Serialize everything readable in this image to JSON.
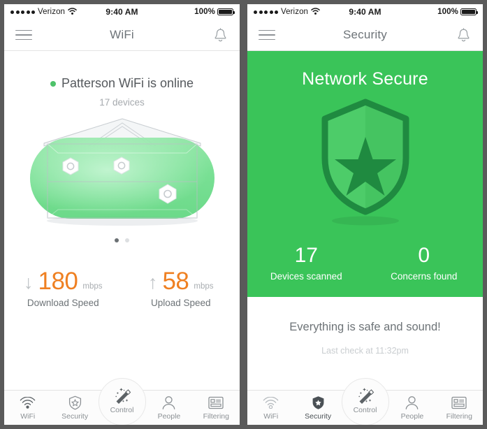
{
  "theme": {
    "green": "#3ac459",
    "orange": "#ef8022",
    "gutter": "#5a5a5a",
    "text_gray": "#6d7377",
    "muted_gray": "#a6aaae"
  },
  "status_bar": {
    "carrier": "Verizon",
    "signal_dots": 5,
    "wifi_icon": "wifi-icon",
    "time": "9:40 AM",
    "battery_percent": "100%",
    "battery_icon": "battery-full-icon"
  },
  "screens": [
    {
      "id": "wifi",
      "nav": {
        "menu_icon": "hamburger-menu-icon",
        "title": "WiFi",
        "notification_icon": "bell-icon"
      },
      "status": {
        "indicator_color": "#4ec26a",
        "text": "Patterson WiFi is online",
        "devices": "17 devices"
      },
      "illustration": "home-network-illustration",
      "pager": {
        "count": 2,
        "active": 0
      },
      "speeds": [
        {
          "direction_icon": "arrow-down-icon",
          "value": "180",
          "unit": "mbps",
          "label": "Download Speed"
        },
        {
          "direction_icon": "arrow-up-icon",
          "value": "58",
          "unit": "mbps",
          "label": "Upload Speed"
        }
      ]
    },
    {
      "id": "security",
      "nav": {
        "menu_icon": "hamburger-menu-icon",
        "title": "Security",
        "notification_icon": "bell-icon"
      },
      "banner": {
        "title": "Network Secure",
        "icon": "shield-star-icon",
        "background": "#3ac459"
      },
      "stats": [
        {
          "value": "17",
          "label": "Devices scanned"
        },
        {
          "value": "0",
          "label": "Concerns found"
        }
      ],
      "footer": {
        "title": "Everything is safe and sound!",
        "subtitle": "Last check at 11:32pm"
      }
    }
  ],
  "tabbar": {
    "items": [
      {
        "label": "WiFi",
        "icon": "wifi-icon"
      },
      {
        "label": "Security",
        "icon": "shield-icon"
      },
      {
        "label": "Control",
        "icon": "magic-wand-icon"
      },
      {
        "label": "People",
        "icon": "person-icon"
      },
      {
        "label": "Filtering",
        "icon": "filter-card-icon"
      }
    ],
    "active": {
      "wifi": "WiFi",
      "security": "Security"
    }
  }
}
